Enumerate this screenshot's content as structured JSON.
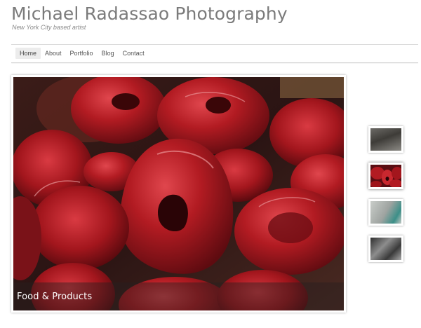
{
  "header": {
    "title": "Michael Radassao Photography",
    "tagline": "New York City based artist"
  },
  "nav": {
    "items": [
      {
        "label": "Home",
        "active": true
      },
      {
        "label": "Portfolio",
        "active": false
      },
      {
        "label": "About",
        "active": false
      },
      {
        "label": "Blog",
        "active": false
      },
      {
        "label": "Contact",
        "active": false
      }
    ]
  },
  "slideshow": {
    "caption": "Food & Products",
    "current_index": 2,
    "thumbnails": [
      {
        "subject": "dark-sink"
      },
      {
        "subject": "red-fruit"
      },
      {
        "subject": "teal-metal"
      },
      {
        "subject": "grey-texture"
      }
    ]
  },
  "colors": {
    "title_gray": "#7b7b7b",
    "nav_active_bg": "#ececec",
    "fruit_red": "#a3161d"
  }
}
